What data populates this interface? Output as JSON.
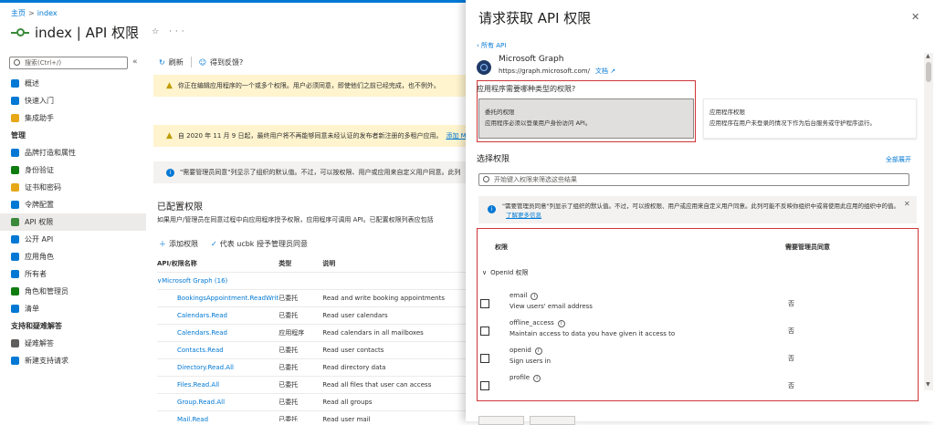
{
  "breadcrumb": {
    "home": "主页",
    "current": "index"
  },
  "page": {
    "title": "index | API 权限",
    "actions": "☆ ···"
  },
  "sidebar": {
    "search_placeholder": "搜索(Ctrl+/)",
    "collapse": "«",
    "items": [
      {
        "label": "概述",
        "icon": "overview-icon",
        "color": "#0078d4",
        "type": "item"
      },
      {
        "label": "快速入门",
        "icon": "cloud-icon",
        "color": "#0078d4",
        "type": "item"
      },
      {
        "label": "集成助手",
        "icon": "rocket-icon",
        "color": "#e6a817",
        "type": "item"
      },
      {
        "label": "管理",
        "type": "section"
      },
      {
        "label": "品牌打造和属性",
        "icon": "branding-icon",
        "color": "#0078d4",
        "type": "item"
      },
      {
        "label": "身份验证",
        "icon": "auth-icon",
        "color": "#107c10",
        "type": "item"
      },
      {
        "label": "证书和密码",
        "icon": "key-icon",
        "color": "#e6a817",
        "type": "item"
      },
      {
        "label": "令牌配置",
        "icon": "token-icon",
        "color": "#0078d4",
        "type": "item"
      },
      {
        "label": "API 权限",
        "icon": "api-permissions-icon",
        "color": "#3a8a3a",
        "type": "item",
        "active": true
      },
      {
        "label": "公开 API",
        "icon": "expose-api-icon",
        "color": "#0078d4",
        "type": "item"
      },
      {
        "label": "应用角色",
        "icon": "app-roles-icon",
        "color": "#0078d4",
        "type": "item"
      },
      {
        "label": "所有者",
        "icon": "owners-icon",
        "color": "#0078d4",
        "type": "item"
      },
      {
        "label": "角色和管理员",
        "icon": "roles-admins-icon",
        "color": "#107c10",
        "type": "item"
      },
      {
        "label": "清单",
        "icon": "manifest-icon",
        "color": "#0078d4",
        "type": "item"
      },
      {
        "label": "支持和疑难解答",
        "type": "section"
      },
      {
        "label": "疑难解答",
        "icon": "wrench-icon",
        "color": "#605e5c",
        "type": "item"
      },
      {
        "label": "新建支持请求",
        "icon": "support-icon",
        "color": "#0078d4",
        "type": "item"
      }
    ]
  },
  "main": {
    "refresh": "刷新",
    "feedback": "得到反馈?",
    "warning1": "你正在编辑应用程序的一个或多个权限。用户必须同意，即使他们之前已经完成，也不例外。",
    "warning2": "自 2020 年 11 月 9 日起，最终用户将不再能够同意未经认证的发布者新注册的多租户应用。",
    "warning2_link": "添加 M",
    "info": "\"需要管理员同意\"列显示了组织的默认值。不过，可以按权限、用户或应用来自定义用户同意。此列",
    "section_title": "已配置权限",
    "section_desc": "如果用户/管理员在同意过程中向应用程序授予权限，应用程序可调用 API。已配置权限列表应包括",
    "add_permission": "添加权限",
    "grant_consent": "代表 ucbk 授予管理员同意",
    "columns": [
      "API/权限名称",
      "类型",
      "说明"
    ],
    "group": "Microsoft Graph (16)",
    "rows": [
      {
        "name": "BookingsAppointment.ReadWrit",
        "type": "已委托",
        "desc": "Read and write booking appointments"
      },
      {
        "name": "Calendars.Read",
        "type": "已委托",
        "desc": "Read user calendars"
      },
      {
        "name": "Calendars.Read",
        "type": "应用程序",
        "desc": "Read calendars in all mailboxes"
      },
      {
        "name": "Contacts.Read",
        "type": "已委托",
        "desc": "Read user contacts"
      },
      {
        "name": "Directory.Read.All",
        "type": "已委托",
        "desc": "Read directory data"
      },
      {
        "name": "Files.Read.All",
        "type": "已委托",
        "desc": "Read all files that user can access"
      },
      {
        "name": "Group.Read.All",
        "type": "已委托",
        "desc": "Read all groups"
      },
      {
        "name": "Mail.Read",
        "type": "已委托",
        "desc": "Read user mail"
      }
    ]
  },
  "panel": {
    "title": "请求获取 API 权限",
    "close": "✕",
    "back": "‹ 所有 API",
    "api_name": "Microsoft Graph",
    "api_url": "https://graph.microsoft.com/",
    "docs": "文档 ↗",
    "question": "应用程序需要哪种类型的权限?",
    "delegated_title": "委托的权限",
    "delegated_desc": "应用程序必须以登录用户身份访问 API。",
    "app_title": "应用程序权限",
    "app_desc": "应用程序在用户未登录的情况下作为后台服务或守护程序运行。",
    "select_title": "选择权限",
    "expand_all": "全部展开",
    "search_placeholder": "开始键入权限来筛选这些结果",
    "info": "\"需要管理员同意\"列显示了组织的默认值。不过，可以按权限、用户或应用来自定义用户同意。此列可能不反映你组织中或将使用此应用的组织中的值。",
    "info_link": "了解更多信息",
    "col_perm": "权限",
    "col_admin": "需要管理员同意",
    "group": "OpenId 权限",
    "perms": [
      {
        "name": "email",
        "desc": "View users' email address",
        "admin": "否"
      },
      {
        "name": "offline_access",
        "desc": "Maintain access to data you have given it access to",
        "admin": "否"
      },
      {
        "name": "openid",
        "desc": "Sign users in",
        "admin": "否"
      },
      {
        "name": "profile",
        "desc": "",
        "admin": "否"
      }
    ]
  }
}
